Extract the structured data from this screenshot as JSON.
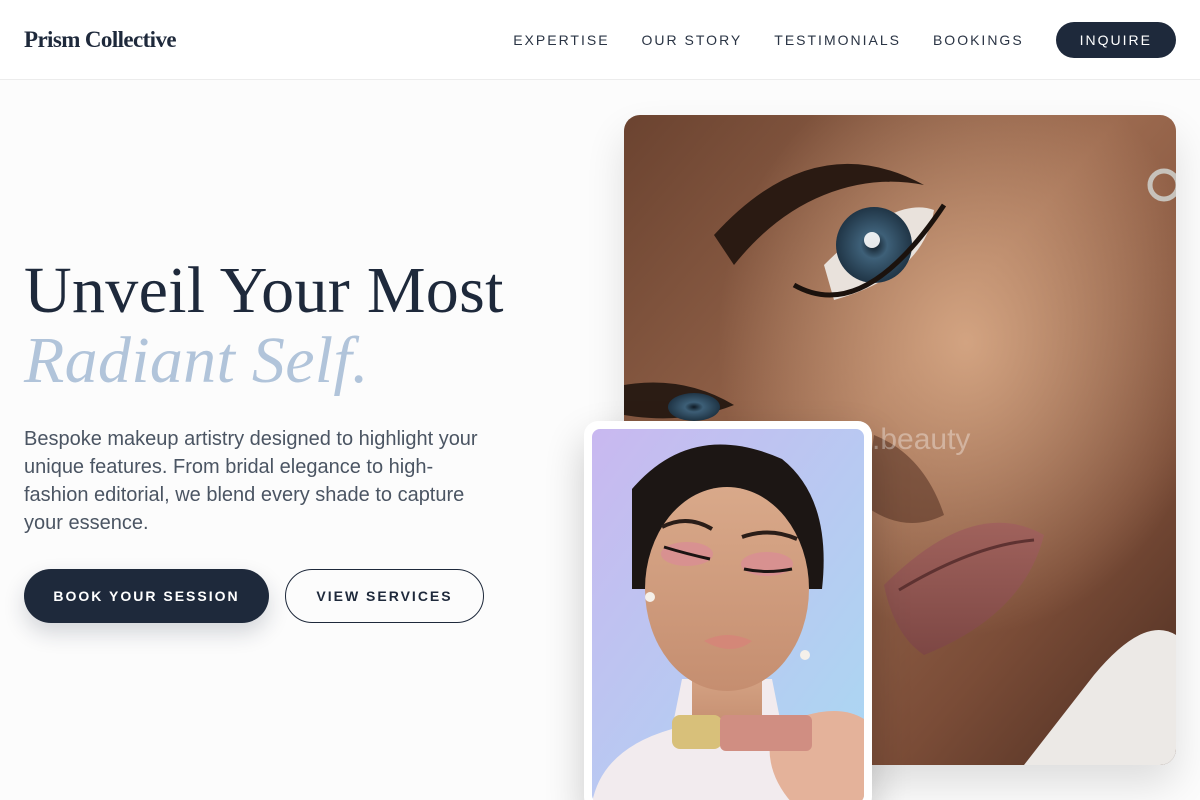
{
  "header": {
    "logo": "Prism Collective",
    "nav": [
      "EXPERTISE",
      "OUR STORY",
      "TESTIMONIALS",
      "BOOKINGS"
    ],
    "cta": "INQUIRE"
  },
  "hero": {
    "title_line1": "Unveil Your Most",
    "title_line2": "Radiant Self.",
    "description": "Bespoke makeup artistry designed to highlight your unique features. From bridal elegance to high-fashion editorial, we blend every shade to capture your essence.",
    "primary_button": "BOOK YOUR SESSION",
    "secondary_button": "VIEW SERVICES"
  },
  "images": {
    "main_watermark": ".beauty"
  },
  "colors": {
    "brand_navy": "#1e293b",
    "accent_blue": "#b1c4da",
    "background": "#fcfcfc"
  }
}
